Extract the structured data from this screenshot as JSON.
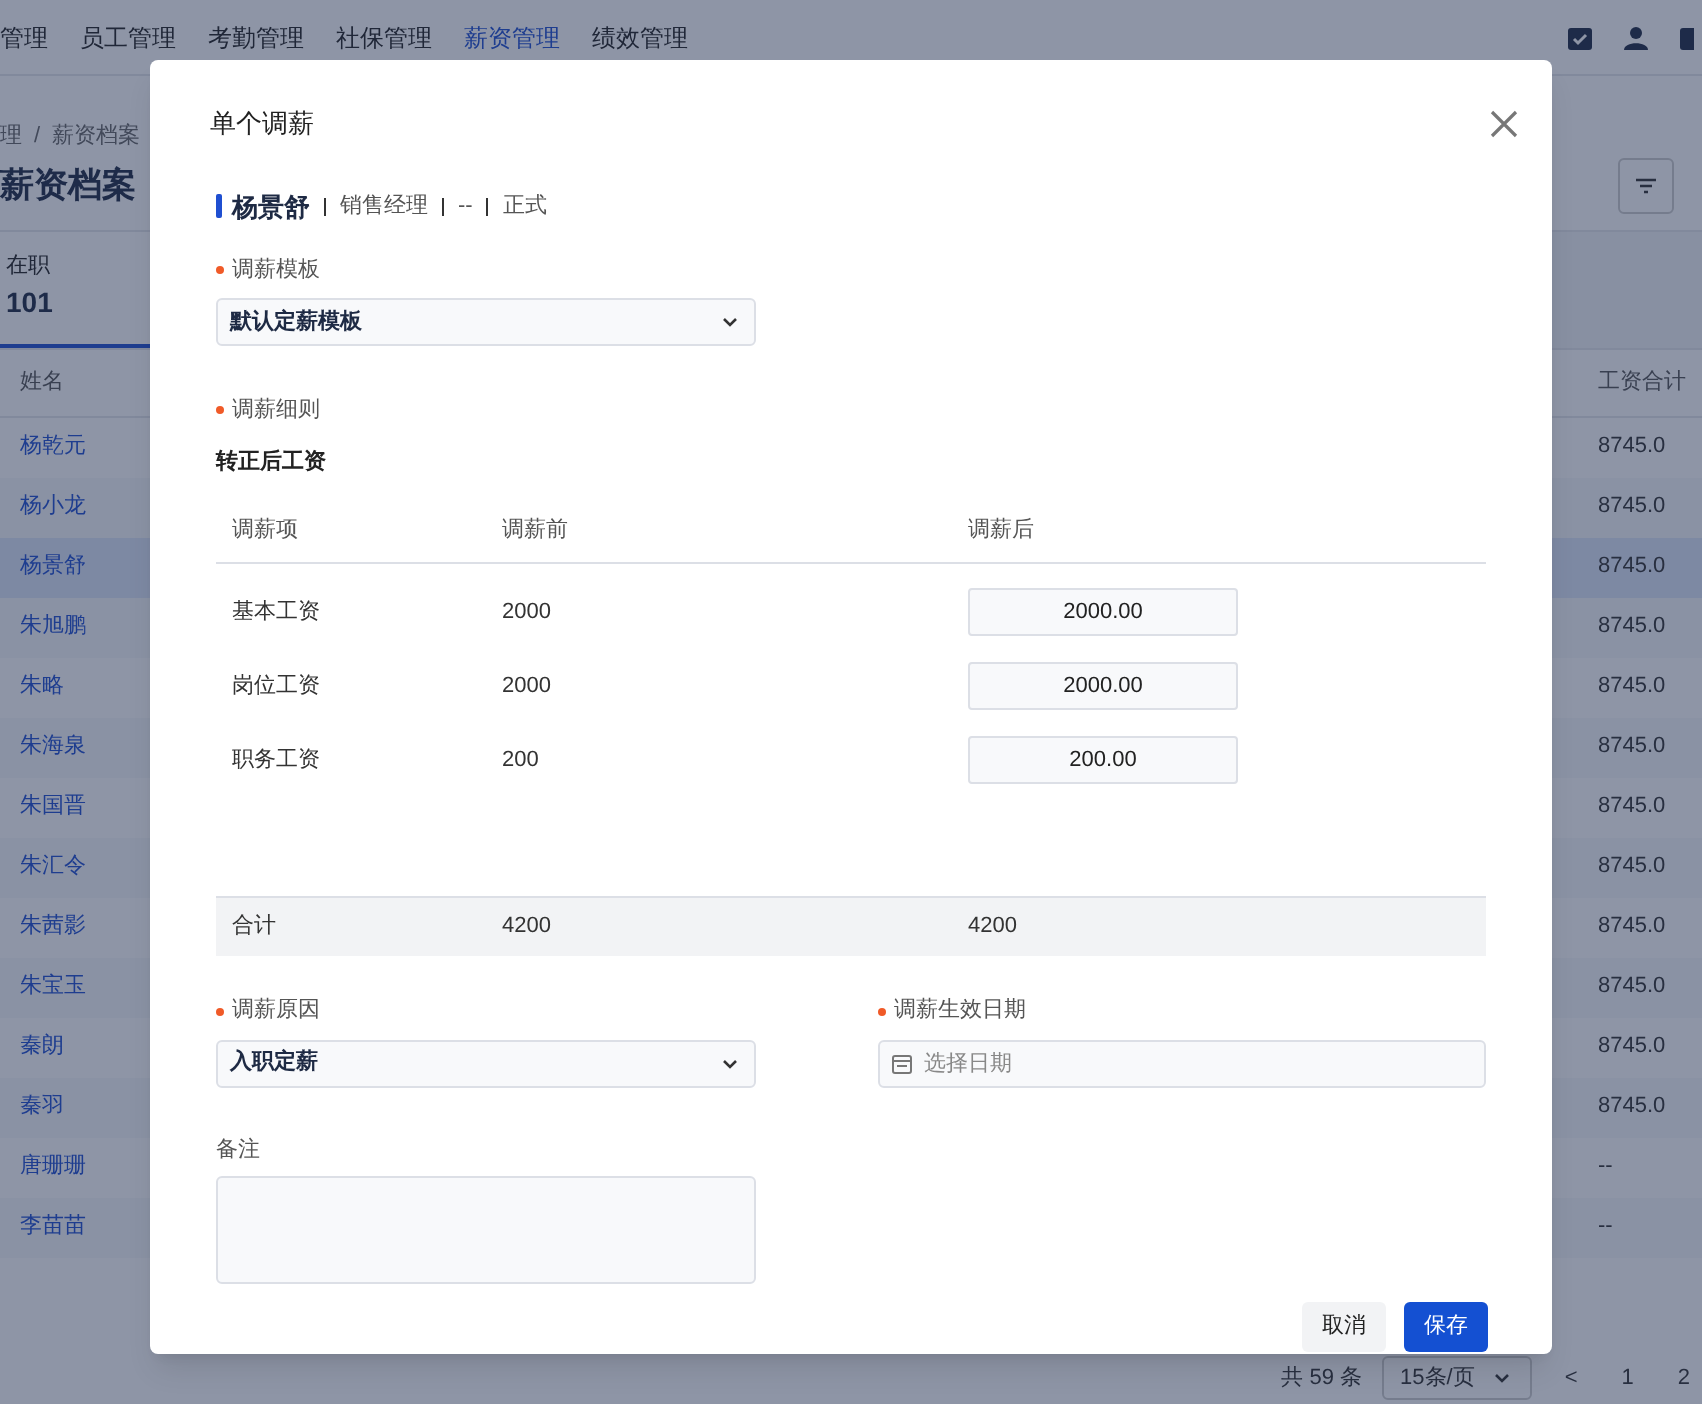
{
  "nav": {
    "items": [
      {
        "label": "管理",
        "selected": false
      },
      {
        "label": "员工管理",
        "selected": false
      },
      {
        "label": "考勤管理",
        "selected": false
      },
      {
        "label": "社保管理",
        "selected": false
      },
      {
        "label": "薪资管理",
        "selected": true
      },
      {
        "label": "绩效管理",
        "selected": false
      }
    ]
  },
  "breadcrumb": {
    "separator": "/",
    "items": [
      "理",
      "薪资档案"
    ]
  },
  "page_title": "薪资档案",
  "status_tab": {
    "label": "在职",
    "count": "101",
    "selected": true
  },
  "table": {
    "columns": [
      "姓名",
      "工资合计"
    ],
    "rows": [
      {
        "name": "杨乾元",
        "total": "8745.0",
        "selected": false
      },
      {
        "name": "杨小龙",
        "total": "8745.0",
        "selected": false
      },
      {
        "name": "杨景舒",
        "total": "8745.0",
        "selected": true
      },
      {
        "name": "朱旭鹏",
        "total": "8745.0",
        "selected": false
      },
      {
        "name": "朱略",
        "total": "8745.0",
        "selected": false
      },
      {
        "name": "朱海泉",
        "total": "8745.0",
        "selected": false
      },
      {
        "name": "朱国晋",
        "total": "8745.0",
        "selected": false
      },
      {
        "name": "朱汇令",
        "total": "8745.0",
        "selected": false
      },
      {
        "name": "朱茜影",
        "total": "8745.0",
        "selected": false
      },
      {
        "name": "朱宝玉",
        "total": "8745.0",
        "selected": false
      },
      {
        "name": "秦朗",
        "total": "8745.0",
        "selected": false
      },
      {
        "name": "秦羽",
        "total": "8745.0",
        "selected": false
      },
      {
        "name": "唐珊珊",
        "total": "--",
        "selected": false
      },
      {
        "name": "李苗苗",
        "total": "--",
        "selected": false
      }
    ]
  },
  "pagination": {
    "total": "共 59 条",
    "page_size": "15条/页",
    "prev": "<",
    "pages": [
      "1",
      "2"
    ]
  },
  "modal": {
    "title": "单个调薪",
    "employee": {
      "name": "杨景舒",
      "details": [
        "销售经理",
        "--",
        "正式"
      ]
    },
    "template": {
      "label": "调薪模板",
      "required": true,
      "value": "默认定薪模板"
    },
    "rules": {
      "label": "调薪细则",
      "required": true,
      "section": "转正后工资",
      "columns": [
        "调薪项",
        "调薪前",
        "调薪后"
      ],
      "rows": [
        {
          "item": "基本工资",
          "before": "2000",
          "after": "2000.00"
        },
        {
          "item": "岗位工资",
          "before": "2000",
          "after": "2000.00"
        },
        {
          "item": "职务工资",
          "before": "200",
          "after": "200.00"
        }
      ],
      "total": {
        "label": "合计",
        "before": "4200",
        "after": "4200"
      }
    },
    "reason": {
      "label": "调薪原因",
      "required": true,
      "value": "入职定薪"
    },
    "effective_date": {
      "label": "调薪生效日期",
      "required": true,
      "placeholder": "选择日期"
    },
    "note": {
      "label": "备注"
    },
    "buttons": [
      {
        "label": "取消",
        "kind": "secondary"
      },
      {
        "label": "保存",
        "kind": "primary"
      }
    ]
  }
}
